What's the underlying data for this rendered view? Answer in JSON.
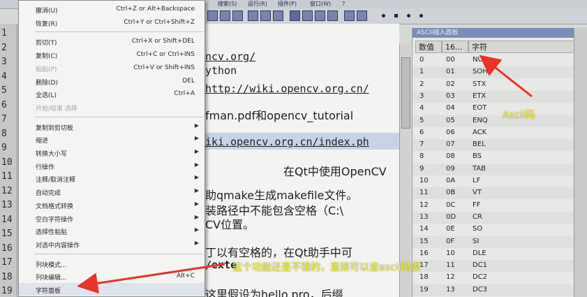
{
  "menubar": {
    "items": [
      "搜索(S)",
      "运行(R)",
      "插件(P)",
      "窗口(W)",
      "?"
    ]
  },
  "gutter": {
    "lines": [
      "1",
      "2",
      "3",
      "4",
      "5",
      "6",
      "7",
      "8",
      "9",
      "10",
      "11",
      "12",
      "13",
      "14",
      "15",
      "16",
      "17",
      "18",
      "19"
    ]
  },
  "editor": {
    "lines": [
      {
        "text": "ncv.org/",
        "cls": "code ul"
      },
      {
        "text": "ython",
        "cls": "code"
      },
      {
        "text": "http://wiki.opencv.org.cn/",
        "cls": "code ul"
      },
      {
        "text": "fman.pdf和opencv_tutorial",
        "cls": "code cjk"
      },
      {
        "text": "iki.opencv.org.cn/index.ph",
        "cls": "code ul"
      },
      {
        "text": "在Qt中使用OpenCV",
        "cls": "code cjk"
      },
      {
        "text": "助qmake生成makefile文件。",
        "cls": "code cjk"
      },
      {
        "text": "装路径中不能包含空格（C:\\",
        "cls": "code cjk"
      },
      {
        "text": "CV位置。",
        "cls": "code cjk"
      },
      {
        "text": "丁以有空格的，在Qt助手中可",
        "cls": "code cjk"
      },
      {
        "text": "/exte",
        "cls": "code"
      },
      {
        "text": "这里假设为hello.pro，后缀",
        "cls": "code cjk"
      }
    ]
  },
  "ascii_panel": {
    "title": "ASCII插入面板",
    "headers": [
      "数值",
      "16...",
      "字符"
    ],
    "rows": [
      [
        "0",
        "00",
        "NUL"
      ],
      [
        "1",
        "01",
        "SOH"
      ],
      [
        "2",
        "02",
        "STX"
      ],
      [
        "3",
        "03",
        "ETX"
      ],
      [
        "4",
        "04",
        "EOT"
      ],
      [
        "5",
        "05",
        "ENQ"
      ],
      [
        "6",
        "06",
        "ACK"
      ],
      [
        "7",
        "07",
        "BEL"
      ],
      [
        "8",
        "08",
        "BS"
      ],
      [
        "9",
        "09",
        "TAB"
      ],
      [
        "10",
        "0A",
        "LF"
      ],
      [
        "11",
        "0B",
        "VT"
      ],
      [
        "12",
        "0C",
        "FF"
      ],
      [
        "13",
        "0D",
        "CR"
      ],
      [
        "14",
        "0E",
        "SO"
      ],
      [
        "15",
        "0F",
        "SI"
      ],
      [
        "16",
        "10",
        "DLE"
      ],
      [
        "17",
        "11",
        "DC1"
      ],
      [
        "18",
        "12",
        "DC2"
      ],
      [
        "19",
        "13",
        "DC3"
      ]
    ]
  },
  "context_menu": {
    "items": [
      {
        "label": "撤消(U)",
        "shortcut": "Ctrl+Z or Alt+Backspace",
        "disabled": false,
        "submenu": false
      },
      {
        "label": "恢复(R)",
        "shortcut": "Ctrl+Y or Ctrl+Shift+Z",
        "disabled": false,
        "submenu": false
      },
      {
        "sep": true
      },
      {
        "label": "剪切(T)",
        "shortcut": "Ctrl+X or Shift+DEL",
        "disabled": false,
        "submenu": false
      },
      {
        "label": "复制(C)",
        "shortcut": "Ctrl+C or Ctrl+INS",
        "disabled": false,
        "submenu": false
      },
      {
        "label": "粘贴(P)",
        "shortcut": "Ctrl+V or Shift+INS",
        "disabled": true,
        "submenu": false
      },
      {
        "label": "删除(D)",
        "shortcut": "DEL",
        "disabled": false,
        "submenu": false
      },
      {
        "label": "全选(L)",
        "shortcut": "Ctrl+A",
        "disabled": false,
        "submenu": false
      },
      {
        "label": "开始/结束 选择",
        "shortcut": "",
        "disabled": true,
        "submenu": false
      },
      {
        "sep": true
      },
      {
        "label": "复制到剪切板",
        "shortcut": "",
        "disabled": false,
        "submenu": true
      },
      {
        "label": "缩进",
        "shortcut": "",
        "disabled": false,
        "submenu": true
      },
      {
        "label": "转换大小写",
        "shortcut": "",
        "disabled": false,
        "submenu": true
      },
      {
        "label": "行操作",
        "shortcut": "",
        "disabled": false,
        "submenu": true
      },
      {
        "label": "注释/取消注释",
        "shortcut": "",
        "disabled": false,
        "submenu": true
      },
      {
        "label": "自动完成",
        "shortcut": "",
        "disabled": false,
        "submenu": true
      },
      {
        "label": "文档格式转换",
        "shortcut": "",
        "disabled": false,
        "submenu": true
      },
      {
        "label": "空白字符操作",
        "shortcut": "",
        "disabled": false,
        "submenu": true
      },
      {
        "label": "选择性粘贴",
        "shortcut": "",
        "disabled": false,
        "submenu": true
      },
      {
        "label": "对选中内容操作",
        "shortcut": "",
        "disabled": false,
        "submenu": true
      },
      {
        "sep": true
      },
      {
        "label": "列块模式...",
        "shortcut": "",
        "disabled": false,
        "submenu": false
      },
      {
        "label": "列块编辑...",
        "shortcut": "Alt+C",
        "disabled": false,
        "submenu": false
      },
      {
        "label": "字符面板",
        "shortcut": "",
        "disabled": false,
        "submenu": false,
        "selected": true
      }
    ]
  },
  "annotations": {
    "ascii_label": "Ascii码",
    "feature_note": "这个功能还是不错的，直接可以查ascii码表"
  },
  "colors": {
    "annotation_arrow": "#e8322c",
    "annotation_text": "#f2f21a",
    "menu_bg": "#f4f4f2",
    "panel_title": "#7a8db8"
  }
}
